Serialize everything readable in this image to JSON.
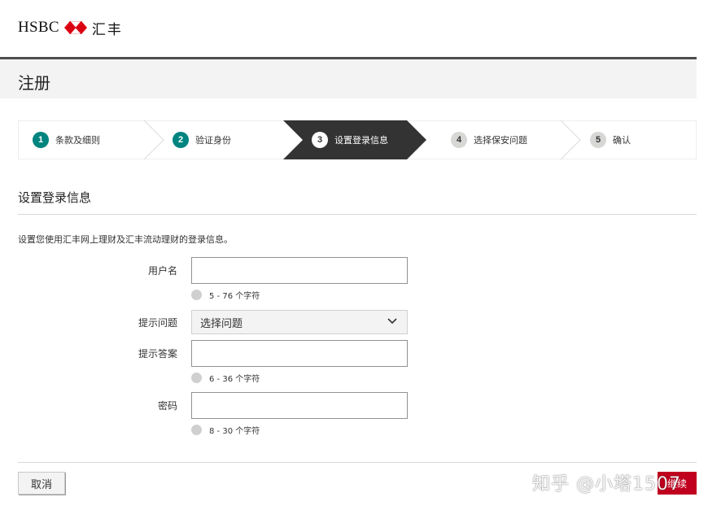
{
  "header": {
    "logo_text": "HSBC",
    "logo_cn": "汇丰",
    "brand_color": "#db0011"
  },
  "page_title": "注册",
  "stepper": {
    "steps": [
      {
        "num": "1",
        "label": "条款及细则",
        "state": "done"
      },
      {
        "num": "2",
        "label": "验证身份",
        "state": "done"
      },
      {
        "num": "3",
        "label": "设置登录信息",
        "state": "active"
      },
      {
        "num": "4",
        "label": "选择保安问题",
        "state": "todo"
      },
      {
        "num": "5",
        "label": "确认",
        "state": "todo"
      }
    ],
    "done_color": "#00847f",
    "active_bg": "#333333"
  },
  "section": {
    "title": "设置登录信息",
    "intro": "设置您使用汇丰网上理财及汇丰流动理财的登录信息。"
  },
  "form": {
    "username": {
      "label": "用户名",
      "value": "",
      "hint": "5 - 76 个字符"
    },
    "question": {
      "label": "提示问题",
      "selected": "选择问题"
    },
    "answer": {
      "label": "提示答案",
      "value": "",
      "hint": "6 - 36 个字符"
    },
    "password": {
      "label": "密码",
      "value": "",
      "hint": "8 - 30 个字符"
    }
  },
  "actions": {
    "cancel_label": "取消",
    "next_label": "继续",
    "next_color": "#c0001e"
  },
  "watermark": "知乎 @小塔1507"
}
